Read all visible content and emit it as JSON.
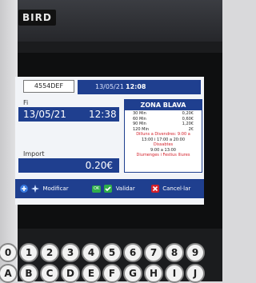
{
  "brand": "BIRD",
  "screen": {
    "plate": "4554DEF",
    "header_date": "13/05/21",
    "header_time": "12:08",
    "fi_label": "Fi",
    "end_date": "13/05/21",
    "end_time": "12:38",
    "import_label": "Import",
    "import_value": "0.20€"
  },
  "zona": {
    "title": "ZONA BLAVA",
    "rates": [
      {
        "duration": "30 Min",
        "price": "0,20€"
      },
      {
        "duration": "60 Min",
        "price": "0,60€"
      },
      {
        "duration": "90 Min",
        "price": "1,20€"
      },
      {
        "duration": "120 Min",
        "price": "2€"
      }
    ],
    "weekday_label": "Dilluns a Divendres: 9:00 a",
    "weekday_hours": "13:00 i 17:00 a 20:00",
    "saturday_label": "Dissabtes",
    "saturday_hours": "9:00 a 13:00",
    "free_note": "Diumenges i Festius lliures"
  },
  "footer": {
    "modify_label": "Modificar",
    "ok_badge": "OK",
    "validate_label": "Validar",
    "cancel_label": "Cancel·lar"
  },
  "keypad": {
    "numbers": [
      "0",
      "1",
      "2",
      "3",
      "4",
      "5",
      "6",
      "7",
      "8",
      "9"
    ],
    "letters": [
      "A",
      "B",
      "C",
      "D",
      "E",
      "F",
      "G",
      "H",
      "I",
      "J"
    ]
  },
  "colors": {
    "screen_blue": "#1f3f8f",
    "tariff_red": "#d4202a",
    "ok_green": "#2fae4a"
  }
}
